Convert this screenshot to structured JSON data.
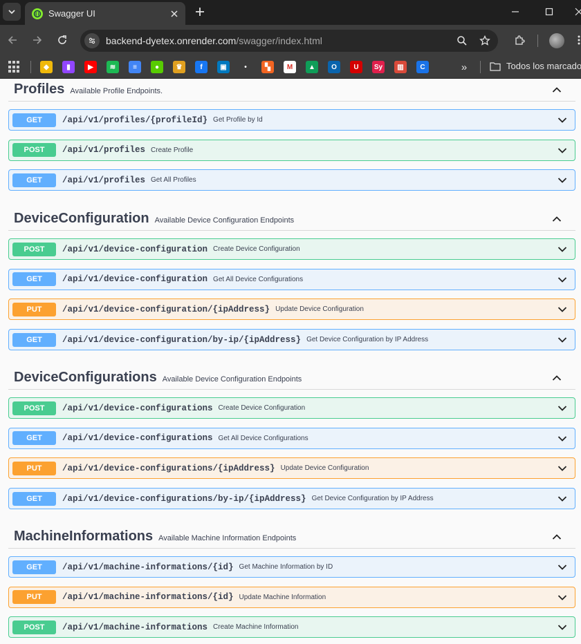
{
  "browser": {
    "tab_title": "Swagger UI",
    "url_host": "backend-dyetex.onrender.com",
    "url_path": "/swagger/index.html",
    "bookmarks_folder": "Todos los marcadores",
    "bookmark_more": "»",
    "bookmarks": [
      {
        "name": "binance",
        "color": "#f0b90b",
        "glyph": "◆"
      },
      {
        "name": "twitch",
        "color": "#9146ff",
        "glyph": "▮"
      },
      {
        "name": "youtube",
        "color": "#ff0000",
        "glyph": "▶"
      },
      {
        "name": "spotify",
        "color": "#1db954",
        "glyph": "≋"
      },
      {
        "name": "google-docs",
        "color": "#4285f4",
        "glyph": "≡"
      },
      {
        "name": "duolingo",
        "color": "#58cc02",
        "glyph": "●"
      },
      {
        "name": "crown",
        "color": "#e0a020",
        "glyph": "♛"
      },
      {
        "name": "facebook",
        "color": "#1877f2",
        "glyph": "f"
      },
      {
        "name": "trello",
        "color": "#0079bf",
        "glyph": "▣"
      },
      {
        "name": "dot",
        "color": "#3c3c3c",
        "glyph": "•"
      },
      {
        "name": "orange-app",
        "color": "#f26522",
        "glyph": "▚"
      },
      {
        "name": "gmail",
        "color": "#ffffff",
        "glyph": "M"
      },
      {
        "name": "google-drive",
        "color": "#0f9d58",
        "glyph": "▲"
      },
      {
        "name": "outlook",
        "color": "#0a64ad",
        "glyph": "O"
      },
      {
        "name": "upc",
        "color": "#d40000",
        "glyph": "U"
      },
      {
        "name": "symbolab",
        "color": "#e0204c",
        "glyph": "Sy"
      },
      {
        "name": "book",
        "color": "#d94a3a",
        "glyph": "▥"
      },
      {
        "name": "c-app",
        "color": "#1a73e8",
        "glyph": "C"
      }
    ]
  },
  "sections": [
    {
      "name": "Profiles",
      "description": "Available Profile Endpoints.",
      "operations": [
        {
          "method": "GET",
          "path": "/api/v1/profiles/{profileId}",
          "summary": "Get Profile by Id"
        },
        {
          "method": "POST",
          "path": "/api/v1/profiles",
          "summary": "Create Profile"
        },
        {
          "method": "GET",
          "path": "/api/v1/profiles",
          "summary": "Get All Profiles"
        }
      ]
    },
    {
      "name": "DeviceConfiguration",
      "description": "Available Device Configuration Endpoints",
      "operations": [
        {
          "method": "POST",
          "path": "/api/v1/device-configuration",
          "summary": "Create Device Configuration"
        },
        {
          "method": "GET",
          "path": "/api/v1/device-configuration",
          "summary": "Get All Device Configurations"
        },
        {
          "method": "PUT",
          "path": "/api/v1/device-configuration/{ipAddress}",
          "summary": "Update Device Configuration"
        },
        {
          "method": "GET",
          "path": "/api/v1/device-configuration/by-ip/{ipAddress}",
          "summary": "Get Device Configuration by IP Address"
        }
      ]
    },
    {
      "name": "DeviceConfigurations",
      "description": "Available Device Configuration Endpoints",
      "operations": [
        {
          "method": "POST",
          "path": "/api/v1/device-configurations",
          "summary": "Create Device Configuration"
        },
        {
          "method": "GET",
          "path": "/api/v1/device-configurations",
          "summary": "Get All Device Configurations"
        },
        {
          "method": "PUT",
          "path": "/api/v1/device-configurations/{ipAddress}",
          "summary": "Update Device Configuration"
        },
        {
          "method": "GET",
          "path": "/api/v1/device-configurations/by-ip/{ipAddress}",
          "summary": "Get Device Configuration by IP Address"
        }
      ]
    },
    {
      "name": "MachineInformations",
      "description": "Available Machine Information Endpoints",
      "operations": [
        {
          "method": "GET",
          "path": "/api/v1/machine-informations/{id}",
          "summary": "Get Machine Information by ID"
        },
        {
          "method": "PUT",
          "path": "/api/v1/machine-informations/{id}",
          "summary": "Update Machine Information"
        },
        {
          "method": "POST",
          "path": "/api/v1/machine-informations",
          "summary": "Create Machine Information"
        }
      ]
    }
  ],
  "colors": {
    "get": "#61affe",
    "post": "#49cc90",
    "put": "#fca130",
    "text": "#3b4151"
  }
}
